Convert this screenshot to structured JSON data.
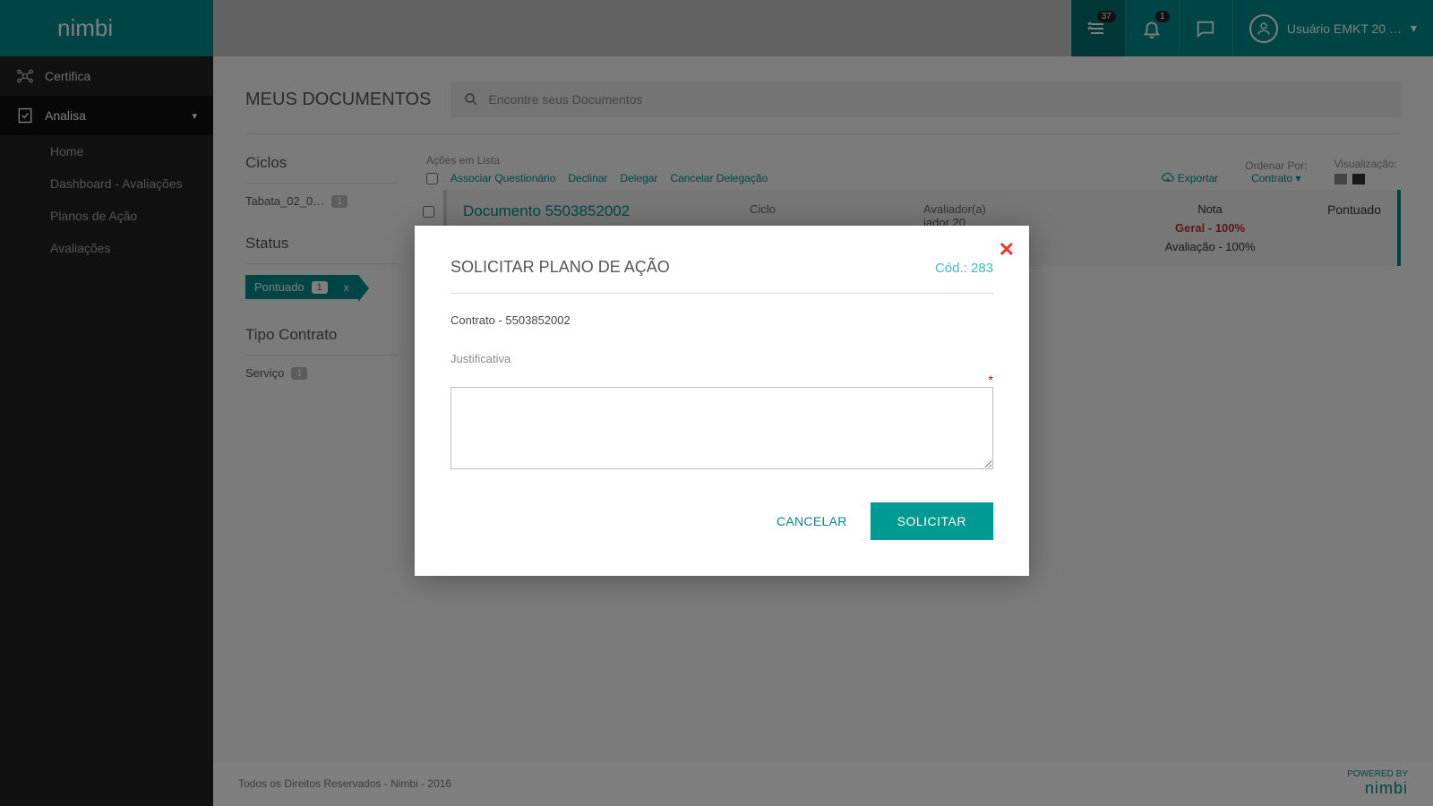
{
  "header": {
    "tasks_badge": "37",
    "notif_badge": "1",
    "user_name": "Usuário EMKT 20 …"
  },
  "sidebar": {
    "certifica": "Certifica",
    "analisa": "Analisa",
    "items": [
      "Home",
      "Dashboard - Avaliações",
      "Planos de Ação",
      "Avaliações"
    ]
  },
  "page": {
    "title": "MEUS DOCUMENTOS",
    "search_placeholder": "Encontre seus Documentos"
  },
  "filters": {
    "ciclos_title": "Ciclos",
    "ciclo_name": "Tabata_02_0…",
    "ciclo_count": "1",
    "status_title": "Status",
    "status_name": "Pontuado",
    "status_count": "1",
    "tipo_title": "Tipo Contrato",
    "tipo_name": "Serviço",
    "tipo_count": "1"
  },
  "listbar": {
    "acoes_label": "Ações em Lista",
    "a1": "Associar Questionário",
    "a2": "Declinar",
    "a3": "Delegar",
    "a4": "Cancelar Delegação",
    "export": "Exportar",
    "sort_label": "Ordenar Por:",
    "sort_value": "Contrato",
    "view_label": "Visualização:"
  },
  "doc": {
    "title": "Documento 5503852002",
    "ciclo_lbl": "Ciclo",
    "aval_lbl": "Avaliador(a)",
    "aval_val": "iador 20",
    "nota_lbl": "Nota",
    "geral": "Geral - 100%",
    "avaliacao": "Avaliação - 100%",
    "status": "Pontuado"
  },
  "footer": {
    "copyright": "Todos os Direitos Reservados - Nimbi - 2016",
    "powered": "POWERED BY"
  },
  "modal": {
    "title": "SOLICITAR PLANO DE AÇÃO",
    "code": "Cód.: 283",
    "contrato": "Contrato  - 5503852002",
    "justificativa": "Justificativa",
    "required": "*",
    "cancel": "CANCELAR",
    "submit": "SOLICITAR"
  }
}
